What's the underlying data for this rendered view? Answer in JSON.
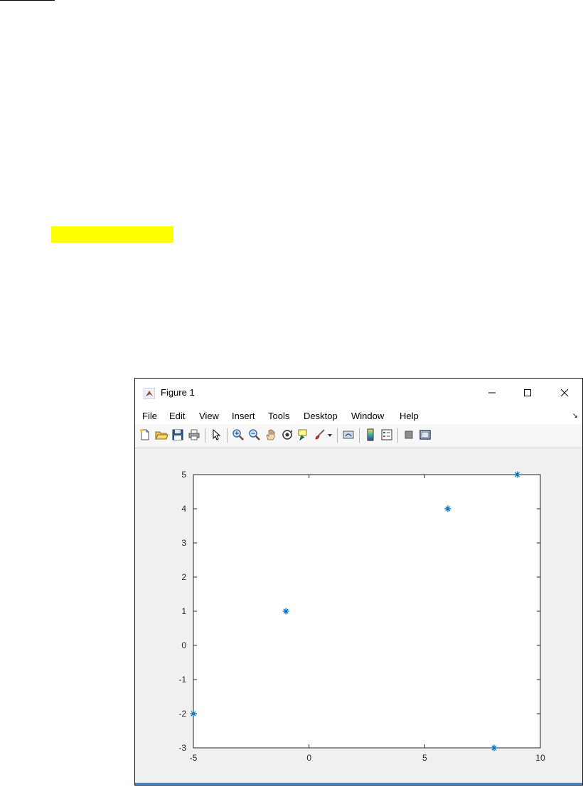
{
  "window": {
    "title": "Figure 1",
    "minimize_icon": "minimize-icon",
    "maximize_icon": "maximize-icon",
    "close_icon": "close-icon"
  },
  "menu": {
    "items": [
      "File",
      "Edit",
      "View",
      "Insert",
      "Tools",
      "Desktop",
      "Window",
      "Help"
    ]
  },
  "toolbar": {
    "icons": [
      "new-figure-icon",
      "open-file-icon",
      "save-icon",
      "print-icon",
      "select-pointer-icon",
      "zoom-in-icon",
      "zoom-out-icon",
      "pan-icon",
      "rotate-3d-icon",
      "data-cursor-icon",
      "brush-icon",
      "link-plot-icon",
      "insert-colorbar-icon",
      "insert-legend-icon",
      "hide-plot-tools-icon",
      "show-plot-tools-icon"
    ]
  },
  "colors": {
    "highlight": "#ffff00",
    "marker": "#0072bd",
    "accent": "#4a7fc1"
  },
  "chart_data": {
    "type": "scatter",
    "marker": "*",
    "x": [
      -5,
      -1,
      6,
      8,
      9
    ],
    "y": [
      -2,
      1,
      4,
      -3,
      5
    ],
    "xlim": [
      -5,
      10
    ],
    "ylim": [
      -3,
      5
    ],
    "xticks": [
      -5,
      0,
      5,
      10
    ],
    "yticks": [
      -3,
      -2,
      -1,
      0,
      1,
      2,
      3,
      4,
      5
    ],
    "grid": false
  }
}
